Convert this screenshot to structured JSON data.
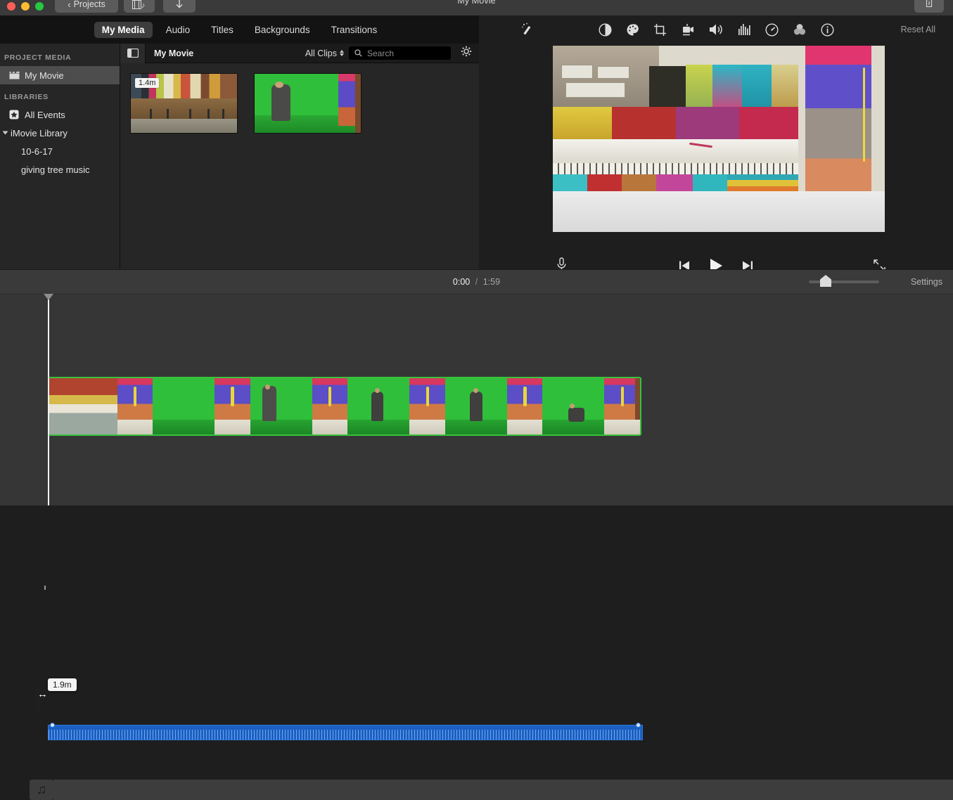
{
  "window": {
    "title": "My Movie",
    "back_button": "Projects",
    "traffic_lights": [
      "close",
      "minimize",
      "zoom"
    ],
    "toolbar_icons": [
      "film-audio-icon",
      "download-icon",
      "share-icon"
    ]
  },
  "tabs": [
    {
      "label": "My Media",
      "active": true
    },
    {
      "label": "Audio",
      "active": false
    },
    {
      "label": "Titles",
      "active": false
    },
    {
      "label": "Backgrounds",
      "active": false
    },
    {
      "label": "Transitions",
      "active": false
    }
  ],
  "sidebar": {
    "project_media_header": "PROJECT MEDIA",
    "project_items": [
      {
        "label": "My Movie",
        "icon": "clapperboard-icon",
        "selected": true
      }
    ],
    "libraries_header": "LIBRARIES",
    "library_items": [
      {
        "label": "All Events",
        "icon": "star-icon",
        "indent": false,
        "disclosure": false
      },
      {
        "label": "iMovie Library",
        "icon": "",
        "indent": false,
        "disclosure": true
      },
      {
        "label": "10-6-17",
        "icon": "",
        "indent": true,
        "disclosure": false
      },
      {
        "label": "giving tree music",
        "icon": "",
        "indent": true,
        "disclosure": false
      }
    ]
  },
  "browser": {
    "sidebar_toggle_icon": "sidebar-toggle-icon",
    "title": "My Movie",
    "filter_label": "All Clips",
    "search_placeholder": "Search",
    "search_value": "",
    "search_icon": "search-icon",
    "settings_icon": "gear-icon",
    "clips": [
      {
        "duration": "1.4m",
        "scene": "classroom"
      },
      {
        "duration": "",
        "scene": "greenscreen"
      }
    ]
  },
  "viewer": {
    "magic_wand_icon": "magic-wand-icon",
    "adjustment_icons": [
      "color-balance-icon",
      "color-correction-icon",
      "crop-icon",
      "stabilization-icon",
      "volume-icon",
      "equalizer-icon",
      "speed-icon",
      "filters-icon",
      "info-icon"
    ],
    "reset_label": "Reset All",
    "controls": {
      "voiceover_icon": "microphone-icon",
      "previous_icon": "skip-previous-icon",
      "play_icon": "play-icon",
      "next_icon": "skip-next-icon",
      "fullscreen_icon": "fullscreen-icon"
    }
  },
  "timeline_toolbar": {
    "current_time": "0:00",
    "separator": "/",
    "total_time": "1:59",
    "settings_label": "Settings",
    "zoom_value": 16
  },
  "timeline": {
    "clip_tooltip": "1.9m",
    "resize_cursor": "↔",
    "music_note_icon": "music-note-icon",
    "selection_color": "#39c23c",
    "audio_color": "#1b5fc0",
    "frames": [
      {
        "type": "classroom"
      },
      {
        "type": "clown"
      },
      {
        "type": "green"
      },
      {
        "type": "clown"
      },
      {
        "type": "green-person-cloth"
      },
      {
        "type": "clown"
      },
      {
        "type": "green-person-walk"
      },
      {
        "type": "clown"
      },
      {
        "type": "green-person-stand"
      },
      {
        "type": "clown"
      },
      {
        "type": "green-person-sit"
      },
      {
        "type": "clown"
      }
    ]
  },
  "colors": {
    "titlebar": "#3a3a3a",
    "tabbar": "#131313",
    "panel": "#262626",
    "viewer_bg": "#1e1e1e",
    "timeline_bg": "#363636",
    "accent_green": "#39c23c",
    "accent_blue": "#1b5fc0"
  }
}
